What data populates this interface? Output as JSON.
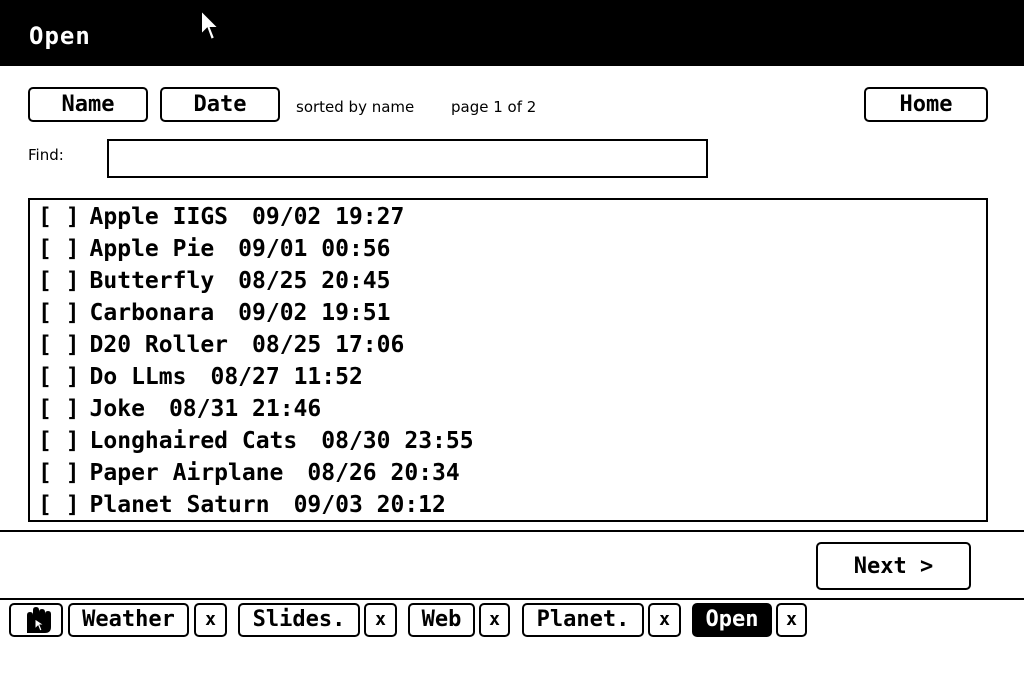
{
  "window": {
    "title": "Open"
  },
  "toolbar": {
    "name_label": "Name",
    "date_label": "Date",
    "sort_status": "sorted by name",
    "page_status": "page 1 of 2",
    "home_label": "Home"
  },
  "find": {
    "label": "Find:",
    "value": "",
    "placeholder": ""
  },
  "files": [
    {
      "checkbox": "[ ]",
      "name": "Apple IIGS",
      "date": "09/02 19:27"
    },
    {
      "checkbox": "[ ]",
      "name": "Apple Pie",
      "date": "09/01 00:56"
    },
    {
      "checkbox": "[ ]",
      "name": "Butterfly",
      "date": "08/25 20:45"
    },
    {
      "checkbox": "[ ]",
      "name": "Carbonara",
      "date": "09/02 19:51"
    },
    {
      "checkbox": "[ ]",
      "name": "D20 Roller",
      "date": "08/25 17:06"
    },
    {
      "checkbox": "[ ]",
      "name": "Do LLms",
      "date": "08/27 11:52"
    },
    {
      "checkbox": "[ ]",
      "name": "Joke",
      "date": "08/31 21:46"
    },
    {
      "checkbox": "[ ]",
      "name": "Longhaired Cats",
      "date": "08/30 23:55"
    },
    {
      "checkbox": "[ ]",
      "name": "Paper Airplane",
      "date": "08/26 20:34"
    },
    {
      "checkbox": "[ ]",
      "name": "Planet Saturn",
      "date": "09/03 20:12"
    }
  ],
  "pager": {
    "next_label": "Next >"
  },
  "taskbar": {
    "app_icon": "hand-cursor-icon",
    "tabs": [
      {
        "label": "Weather",
        "close": "x"
      },
      {
        "label": "Slides.",
        "close": "x"
      },
      {
        "label": "Web",
        "close": "x"
      },
      {
        "label": "Planet.",
        "close": "x"
      },
      {
        "label": "Open",
        "close": "x",
        "active": true
      }
    ]
  },
  "colors": {
    "background": "#ffffff",
    "foreground": "#000000"
  }
}
